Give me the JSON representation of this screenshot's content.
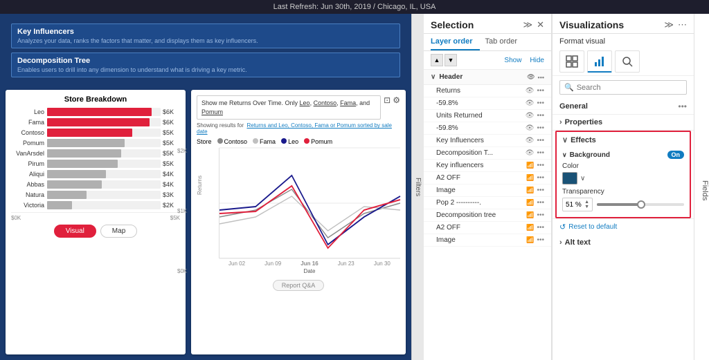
{
  "topbar": {
    "text": "Last Refresh: Jun 30th, 2019 / Chicago, IL, USA"
  },
  "canvas": {
    "ki_items": [
      {
        "title": "Key Influencers",
        "desc": "Analyzes your data, ranks the factors that matter, and displays them as key influencers."
      },
      {
        "title": "Decomposition Tree",
        "desc": "Enables users to drill into any dimension to understand what is driving a key metric."
      }
    ],
    "store_breakdown": {
      "title": "Store Breakdown",
      "bars": [
        {
          "label": "Leo",
          "value": "$6K",
          "pct": 92,
          "type": "red"
        },
        {
          "label": "Fama",
          "value": "$6K",
          "pct": 90,
          "type": "red"
        },
        {
          "label": "Contoso",
          "value": "$5K",
          "pct": 75,
          "type": "red"
        },
        {
          "label": "Pomum",
          "value": "$5K",
          "pct": 68,
          "type": "gray"
        },
        {
          "label": "VanArsdel",
          "value": "$5K",
          "pct": 65,
          "type": "gray"
        },
        {
          "label": "Pirum",
          "value": "$5K",
          "pct": 62,
          "type": "gray"
        },
        {
          "label": "Aliqui",
          "value": "$4K",
          "pct": 52,
          "type": "gray"
        },
        {
          "label": "Abbas",
          "value": "$4K",
          "pct": 48,
          "type": "gray"
        },
        {
          "label": "Natura",
          "value": "$3K",
          "pct": 35,
          "type": "gray"
        },
        {
          "label": "Victoria",
          "value": "$2K",
          "pct": 22,
          "type": "gray"
        }
      ],
      "x_labels": [
        "$0K",
        "$5K"
      ],
      "btn_visual": "Visual",
      "btn_map": "Map"
    },
    "line_chart": {
      "query": "Show me Returns Over Time. Only Leo, Contoso, Fama, and Pomum",
      "showing_label": "Showing results for",
      "showing_link": "Returns and Leo, Contoso, Fama or Pomum sorted by sale date",
      "store_label": "Store",
      "legend": [
        {
          "name": "Contoso",
          "color": "#888"
        },
        {
          "name": "Fama",
          "color": "#c8c8c8"
        },
        {
          "name": "Leo",
          "color": "#1a1a8c"
        },
        {
          "name": "Pomum",
          "color": "#e0203c"
        }
      ],
      "y_labels": [
        "$2K",
        "$1K",
        "$0K"
      ],
      "x_labels": [
        "Jun 02",
        "Jun 09",
        "Jun 16",
        "Jun 23",
        "Jun 30"
      ],
      "x_axis_label": "Date",
      "y_axis_label": "Returns",
      "footer_btn": "Report Q&A"
    }
  },
  "filters": {
    "label": "Filters"
  },
  "selection": {
    "title": "Selection",
    "tabs": [
      {
        "label": "Layer order",
        "active": true
      },
      {
        "label": "Tab order",
        "active": false
      }
    ],
    "show_label": "Show",
    "hide_label": "Hide",
    "group_header": "Header",
    "items": [
      {
        "name": "Returns"
      },
      {
        "name": "-59.8%"
      },
      {
        "name": "Units Returned"
      },
      {
        "name": "-59.8%"
      },
      {
        "name": "Key Influencers"
      },
      {
        "name": "Decomposition T..."
      },
      {
        "name": "Key influencers"
      },
      {
        "name": "A2 OFF"
      },
      {
        "name": "Image"
      },
      {
        "name": "Pop 2 ---------."
      },
      {
        "name": "Decomposition tree"
      },
      {
        "name": "A2 OFF"
      },
      {
        "name": "Image"
      }
    ]
  },
  "visualizations": {
    "title": "Visualizations",
    "format_label": "Format visual",
    "icons": [
      {
        "name": "table-icon",
        "glyph": "⊞"
      },
      {
        "name": "chart-icon",
        "glyph": "📊",
        "active": true
      },
      {
        "name": "search-vis-icon",
        "glyph": "🔍"
      }
    ],
    "search_placeholder": "Search",
    "general_label": "General",
    "properties_label": "Properties",
    "effects_label": "Effects",
    "background_label": "Background",
    "toggle_label": "On",
    "color_label": "Color",
    "transparency_label": "Transparency",
    "transparency_value": "51 %",
    "reset_label": "Reset to default",
    "alt_text_label": "Alt text"
  }
}
